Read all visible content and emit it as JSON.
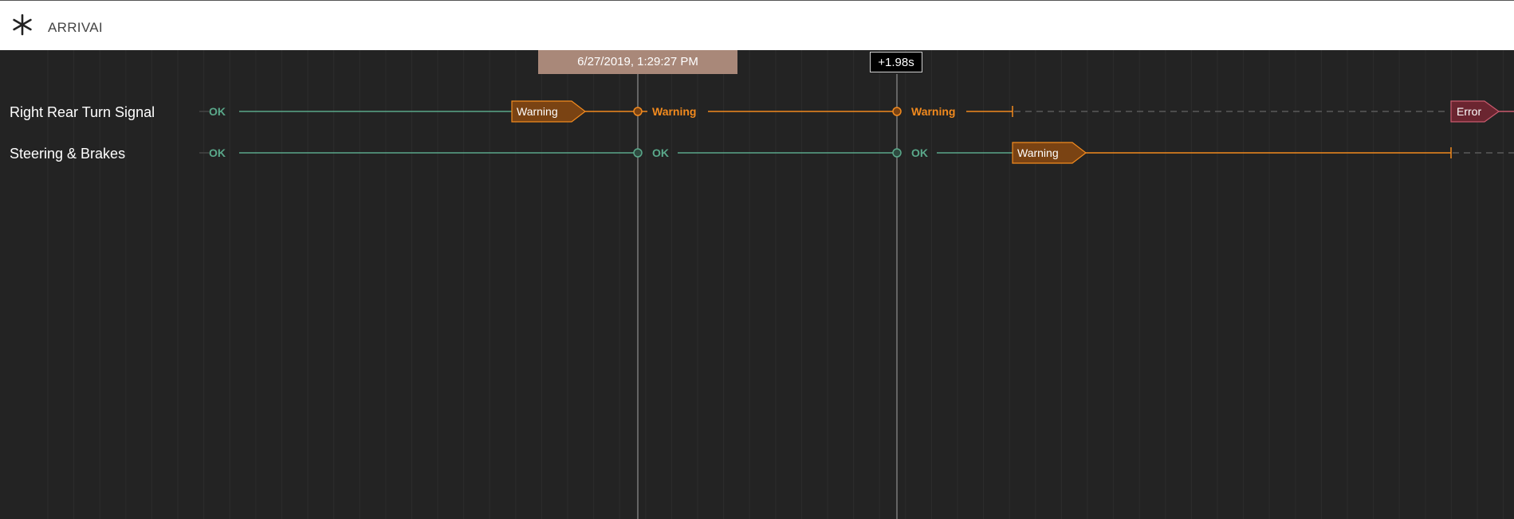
{
  "header": {
    "logo_icon": "asterisk-icon",
    "title": "ARRIVAI"
  },
  "cursors": {
    "date_label": "6/27/2019, 1:29:27 PM",
    "delta_label": "+1.98s"
  },
  "rows": [
    {
      "label": "Right Rear Turn Signal",
      "states": [
        "OK",
        "Warning",
        "Warning",
        "Warning",
        "Error"
      ]
    },
    {
      "label": "Steering & Brakes",
      "states": [
        "OK",
        "OK",
        "OK",
        "Warning"
      ]
    }
  ],
  "colors": {
    "ok": "#5aa88a",
    "warning": "#f28a1e",
    "warning_fill": "#7a4313",
    "error": "#c95a6e",
    "error_fill": "#6b2530",
    "background": "#232323"
  }
}
